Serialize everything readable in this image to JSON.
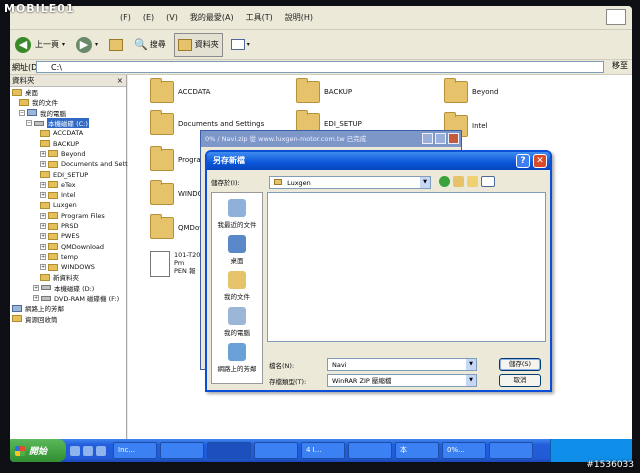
{
  "logo": {
    "text": "MOBILE01"
  },
  "watermark": "#1536033",
  "explorer": {
    "menu": [
      "(F)",
      "(E)",
      "(V)",
      "我的最愛(A)",
      "工具(T)",
      "說明(H)"
    ],
    "toolbar": {
      "back": "上一頁",
      "search": "搜尋",
      "folders": "資料夾"
    },
    "address": {
      "label": "網址(D)",
      "value": "C:\\",
      "go": "移至"
    },
    "folder_pane": {
      "title": "資料夾",
      "close": "×",
      "tree": [
        "桌面",
        "我的文件",
        "我的電腦",
        "本機磁碟 (C:)",
        "ACCDATA",
        "BACKUP",
        "Beyond",
        "Documents and Settings",
        "EDI_SETUP",
        "eTex",
        "Intel",
        "Luxgen",
        "Program Files",
        "PRSD",
        "PWES",
        "QMDownload",
        "temp",
        "WINDOWS",
        "新資料夾",
        "本機磁碟 (D:)",
        "DVD-RAM 磁碟機 (F:)",
        "網路上的芳鄰",
        "資源回收筒"
      ]
    },
    "files": [
      "ACCDATA",
      "BACKUP",
      "Beyond",
      "Documents and Settings",
      "EDI_SETUP",
      "Intel",
      "Program",
      "WINDO",
      "QMDow"
    ],
    "doc_file": {
      "line1": "101-T20",
      "line2": "Pm",
      "line3": "PEN 報"
    }
  },
  "progress_dialog": {
    "title": "0% / Navi.zip 從 www.luxgen-motor.com.tw 已完成"
  },
  "save_dialog": {
    "title": "另存新檔",
    "help": "?",
    "close": "✕",
    "look_in_label": "儲存於(I):",
    "look_in_value": "Luxgen",
    "places": [
      "我最近的文件",
      "桌面",
      "我的文件",
      "我的電腦",
      "網路上的芳鄰"
    ],
    "filename_label": "檔名(N):",
    "filename_value": "Navi",
    "filetype_label": "存檔類型(T):",
    "filetype_value": "WinRAR ZIP 壓縮檔",
    "save_button": "儲存(S)",
    "cancel_button": "取消"
  },
  "taskbar": {
    "start": "開始",
    "tasks": [
      "Inc...",
      "",
      "",
      "",
      "4 I...",
      "",
      "本",
      "0%...",
      ""
    ]
  }
}
